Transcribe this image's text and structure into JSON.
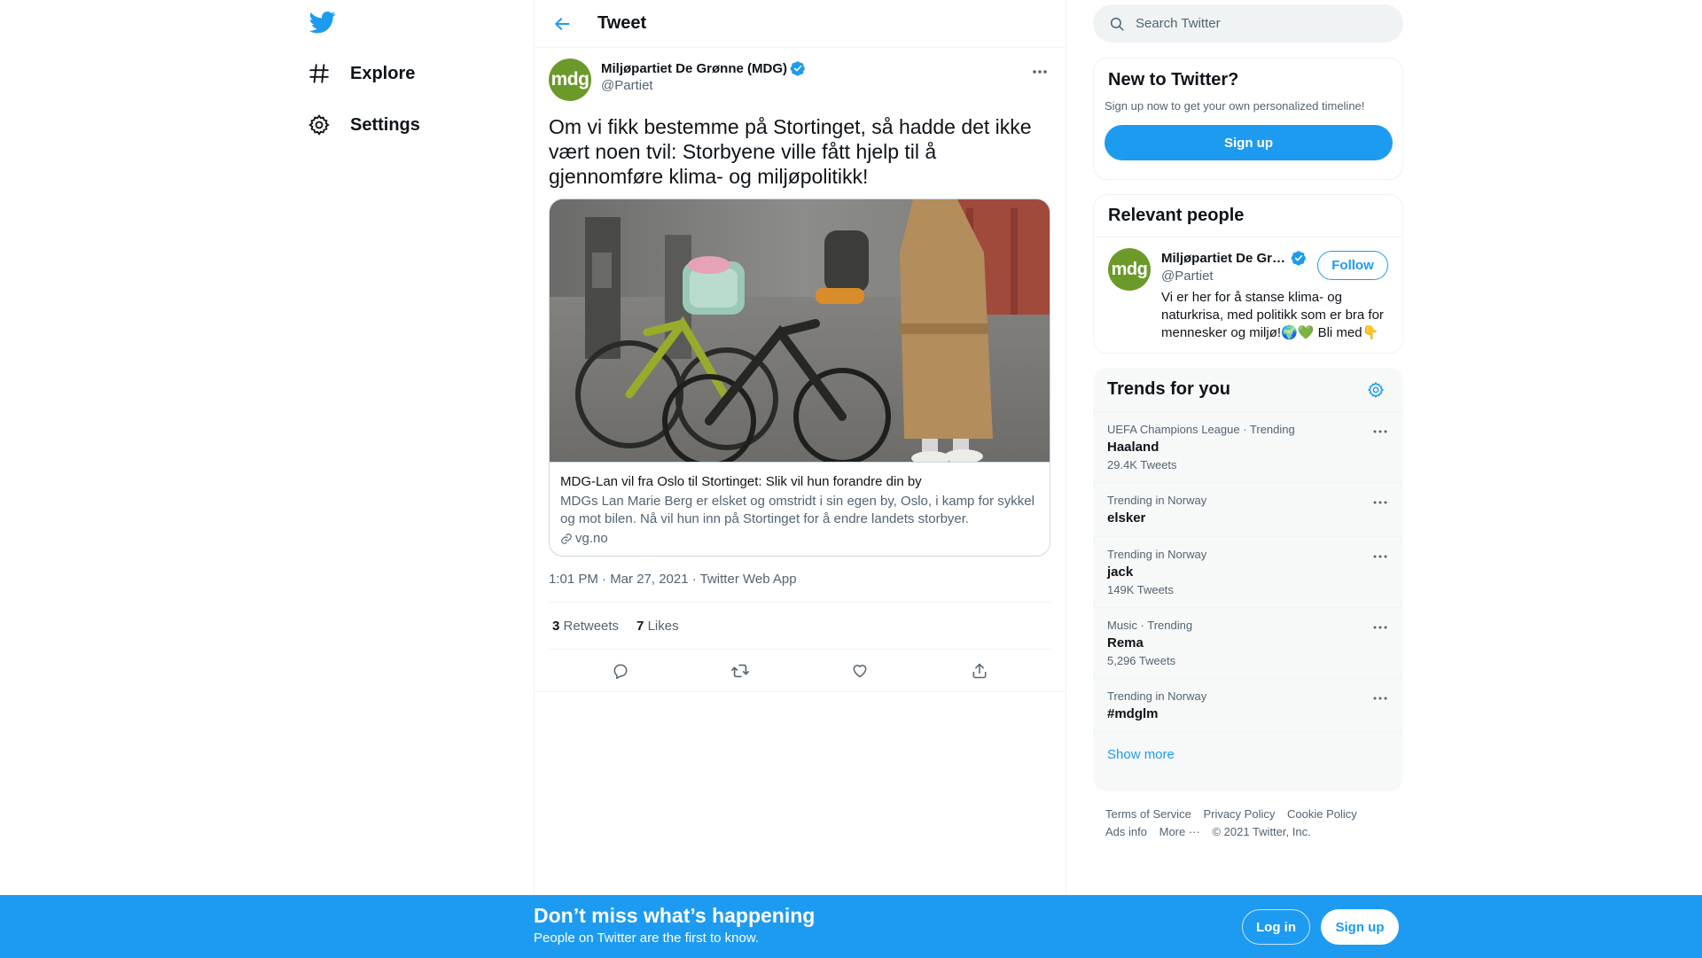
{
  "nav": {
    "logo_icon": "twitter-bird-icon",
    "items": [
      {
        "label": "Explore",
        "icon": "hashtag-icon"
      },
      {
        "label": "Settings",
        "icon": "gear-icon"
      }
    ]
  },
  "main": {
    "header_title": "Tweet",
    "tweet": {
      "author_name": "Miljøpartiet De Grønne (MDG)",
      "author_handle": "@Partiet",
      "avatar_text": "mdg",
      "text": "Om vi fikk bestemme på Stortinget, så hadde det ikke vært noen tvil: Storbyene ville fått hjelp til å gjennomføre klima- og miljøpolitikk!",
      "card": {
        "title": "MDG-Lan vil fra Oslo til Stortinget: Slik vil hun forandre din by",
        "description": "MDGs Lan Marie Berg er elsket og omstridt i sin egen by, Oslo, i kamp for sykkel og mot bilen. Nå vil hun inn på Stortinget for å endre landets storbyer.",
        "domain": "vg.no"
      },
      "timestamp": "1:01 PM · Mar 27, 2021 · Twitter Web App",
      "retweets_count": "3",
      "retweets_label": "Retweets",
      "likes_count": "7",
      "likes_label": "Likes"
    }
  },
  "sidebar": {
    "search_placeholder": "Search Twitter",
    "new_box": {
      "title": "New to Twitter?",
      "subtitle": "Sign up now to get your own personalized timeline!",
      "signup_label": "Sign up"
    },
    "people": {
      "title": "Relevant people",
      "name": "Miljøpartiet De Grønne (MDG)",
      "handle": "@Partiet",
      "avatar_text": "mdg",
      "bio": "Vi er her for å stanse klima- og naturkrisa, med politikk som er bra for mennesker og miljø!🌍💚 Bli med👇",
      "follow_label": "Follow"
    },
    "trends": {
      "title": "Trends for you",
      "items": [
        {
          "meta": "UEFA Champions League · Trending",
          "name": "Haaland",
          "count": "29.4K Tweets"
        },
        {
          "meta": "Trending in Norway",
          "name": "elsker",
          "count": ""
        },
        {
          "meta": "Trending in Norway",
          "name": "jack",
          "count": "149K Tweets"
        },
        {
          "meta": "Music · Trending",
          "name": "Rema",
          "count": "5,296 Tweets"
        },
        {
          "meta": "Trending in Norway",
          "name": "#mdglm",
          "count": ""
        }
      ],
      "show_more": "Show more"
    },
    "footer": {
      "terms": "Terms of Service",
      "privacy": "Privacy Policy",
      "cookie": "Cookie Policy",
      "ads": "Ads info",
      "more": "More ···",
      "copyright": "© 2021 Twitter, Inc."
    }
  },
  "bottom_bar": {
    "title": "Don’t miss what’s happening",
    "subtitle": "People on Twitter are the first to know.",
    "login_label": "Log in",
    "signup_label": "Sign up"
  },
  "colors": {
    "accent": "#1d9bf0",
    "avatar_green": "#6c9a2a",
    "text_secondary": "#536471"
  }
}
